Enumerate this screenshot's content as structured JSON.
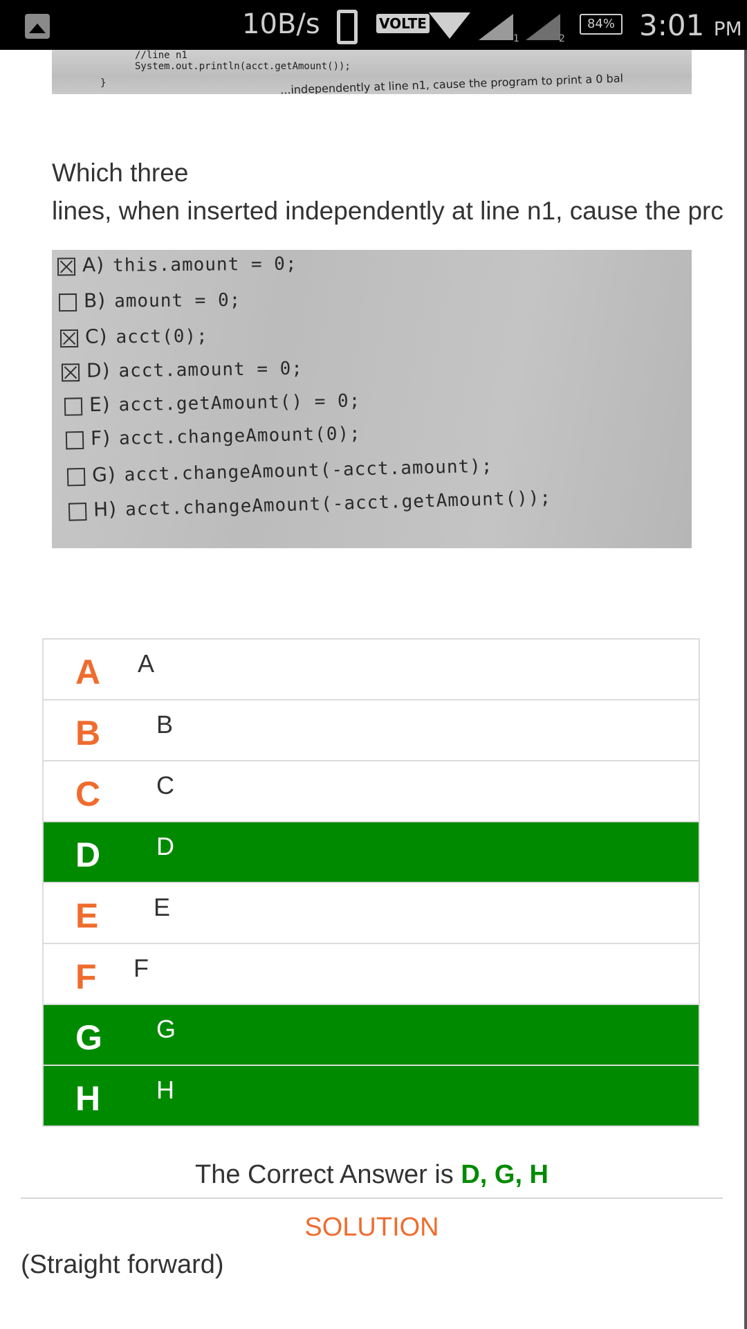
{
  "status_bar": {
    "speed": "10B/s",
    "volte": "VOLTE",
    "sim1": "1",
    "sim2": "2",
    "battery": "84%",
    "time": "3:01",
    "ampm": "PM"
  },
  "code_snippet": {
    "line1": "//line n1",
    "line2": "System.out.println(acct.getAmount());",
    "brace": "}",
    "tail": "...independently at line n1, cause the program to print a 0 bal"
  },
  "question": {
    "line1": "Which three",
    "line2": "lines, when inserted independently at line n1, cause the prc"
  },
  "options_image": [
    {
      "letter": "A)",
      "code": "this.amount = 0;",
      "checked": true
    },
    {
      "letter": "B)",
      "code": "amount = 0;",
      "checked": false
    },
    {
      "letter": "C)",
      "code": "acct(0);",
      "checked": true
    },
    {
      "letter": "D)",
      "code": "acct.amount = 0;",
      "checked": true
    },
    {
      "letter": "E)",
      "code": "acct.getAmount() = 0;",
      "checked": false
    },
    {
      "letter": "F)",
      "code": "acct.changeAmount(0);",
      "checked": false
    },
    {
      "letter": "G)",
      "code": "acct.changeAmount(-acct.amount);",
      "checked": false
    },
    {
      "letter": "H)",
      "code": "acct.changeAmount(-acct.getAmount());",
      "checked": false
    }
  ],
  "answers": [
    {
      "letter": "A",
      "text": "A",
      "correct": false
    },
    {
      "letter": "B",
      "text": "B",
      "correct": false
    },
    {
      "letter": "C",
      "text": "C",
      "correct": false
    },
    {
      "letter": "D",
      "text": "D",
      "correct": true
    },
    {
      "letter": "E",
      "text": "E",
      "correct": false
    },
    {
      "letter": "F",
      "text": "F",
      "correct": false
    },
    {
      "letter": "G",
      "text": "G",
      "correct": true
    },
    {
      "letter": "H",
      "text": "H",
      "correct": true
    }
  ],
  "result": {
    "prefix": "The Correct Answer is ",
    "value": "D, G, H"
  },
  "solution": {
    "heading": "SOLUTION",
    "text": "(Straight forward)"
  },
  "colors": {
    "accent_orange": "#ef6c2e",
    "correct_green": "#008a00"
  }
}
